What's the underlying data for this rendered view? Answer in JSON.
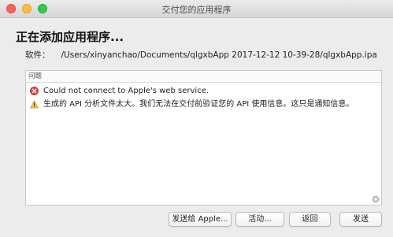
{
  "window": {
    "title": "交付您的应用程序"
  },
  "heading": "正在添加应用程序...",
  "software": {
    "label": "软件：",
    "path": "/Users/xinyanchao/Documents/qlgxbApp 2017-12-12 10-39-28/qlgxbApp.ipa"
  },
  "issues": {
    "header": "问题",
    "items": [
      {
        "icon": "error-icon",
        "text": "Could not connect to Apple's web service."
      },
      {
        "icon": "warning-icon",
        "text": "生成的 API 分析文件太大。我们无法在交付前验证您的 API 使用信息。这只是通知信息。"
      }
    ]
  },
  "buttons": {
    "send_to_apple": "发送给 Apple...",
    "activity": "活动...",
    "back": "返回",
    "send": "发送"
  },
  "colors": {
    "error": "#e0443e",
    "warning": "#f5c242"
  }
}
